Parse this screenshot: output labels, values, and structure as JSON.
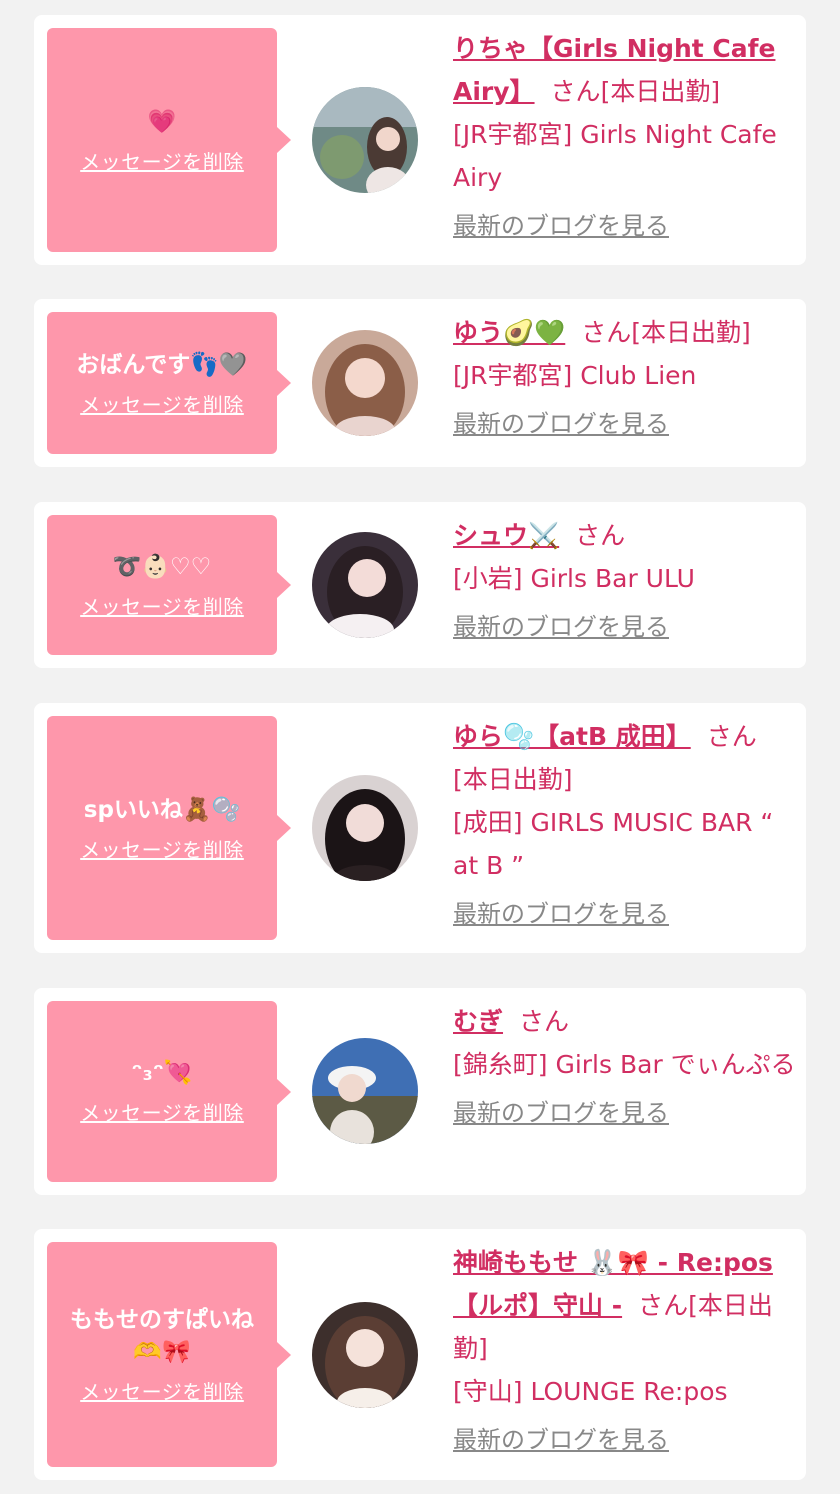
{
  "common": {
    "delete_label": "メッセージを削除",
    "blog_label": "最新のブログを見る",
    "san_label": "さん"
  },
  "colors": {
    "page_bg": "#f2f2f2",
    "card_bg": "#ffffff",
    "bubble_bg": "#fe97ab",
    "accent_text": "#d12e62",
    "muted_link": "#888888"
  },
  "entries": [
    {
      "message": "💗",
      "name": "りちゃ【Girls Night Cafe Airy】",
      "status": "[本日出勤]",
      "shop": "[JR宇都宮] Girls Night Cafe Airy",
      "avatar_icon": "cat-ear-girl-avatar"
    },
    {
      "message": "おばんです👣🩶",
      "name": "ゆう🥑💚",
      "status": "[本日出勤]",
      "shop": "[JR宇都宮] Club Lien",
      "avatar_icon": "girl-avatar"
    },
    {
      "message": "➰👶🏻♡♡",
      "name": "シュウ⚔️",
      "status": "",
      "shop": "[小岩] Girls Bar ULU",
      "avatar_icon": "girl-avatar"
    },
    {
      "message": "spいいね🧸🫧",
      "name": "ゆら🫧【atB 成田】",
      "status": "[本日出勤]",
      "shop": "[成田] GIRLS MUSIC BAR “ at B ”",
      "avatar_icon": "girl-avatar"
    },
    {
      "message": "ᵔ₃ᵔ💘",
      "name": "むぎ",
      "status": "",
      "shop": "[錦糸町] Girls Bar でぃんぷる",
      "avatar_icon": "girl-in-hat-avatar"
    },
    {
      "message": "ももせのすぱいね🫶🎀",
      "name": "神崎ももせ 🐰🎀 - Re:pos【ルポ】守山 -",
      "status": "[本日出勤]",
      "shop": "[守山] LOUNGE Re:pos",
      "avatar_icon": "girl-avatar"
    }
  ]
}
